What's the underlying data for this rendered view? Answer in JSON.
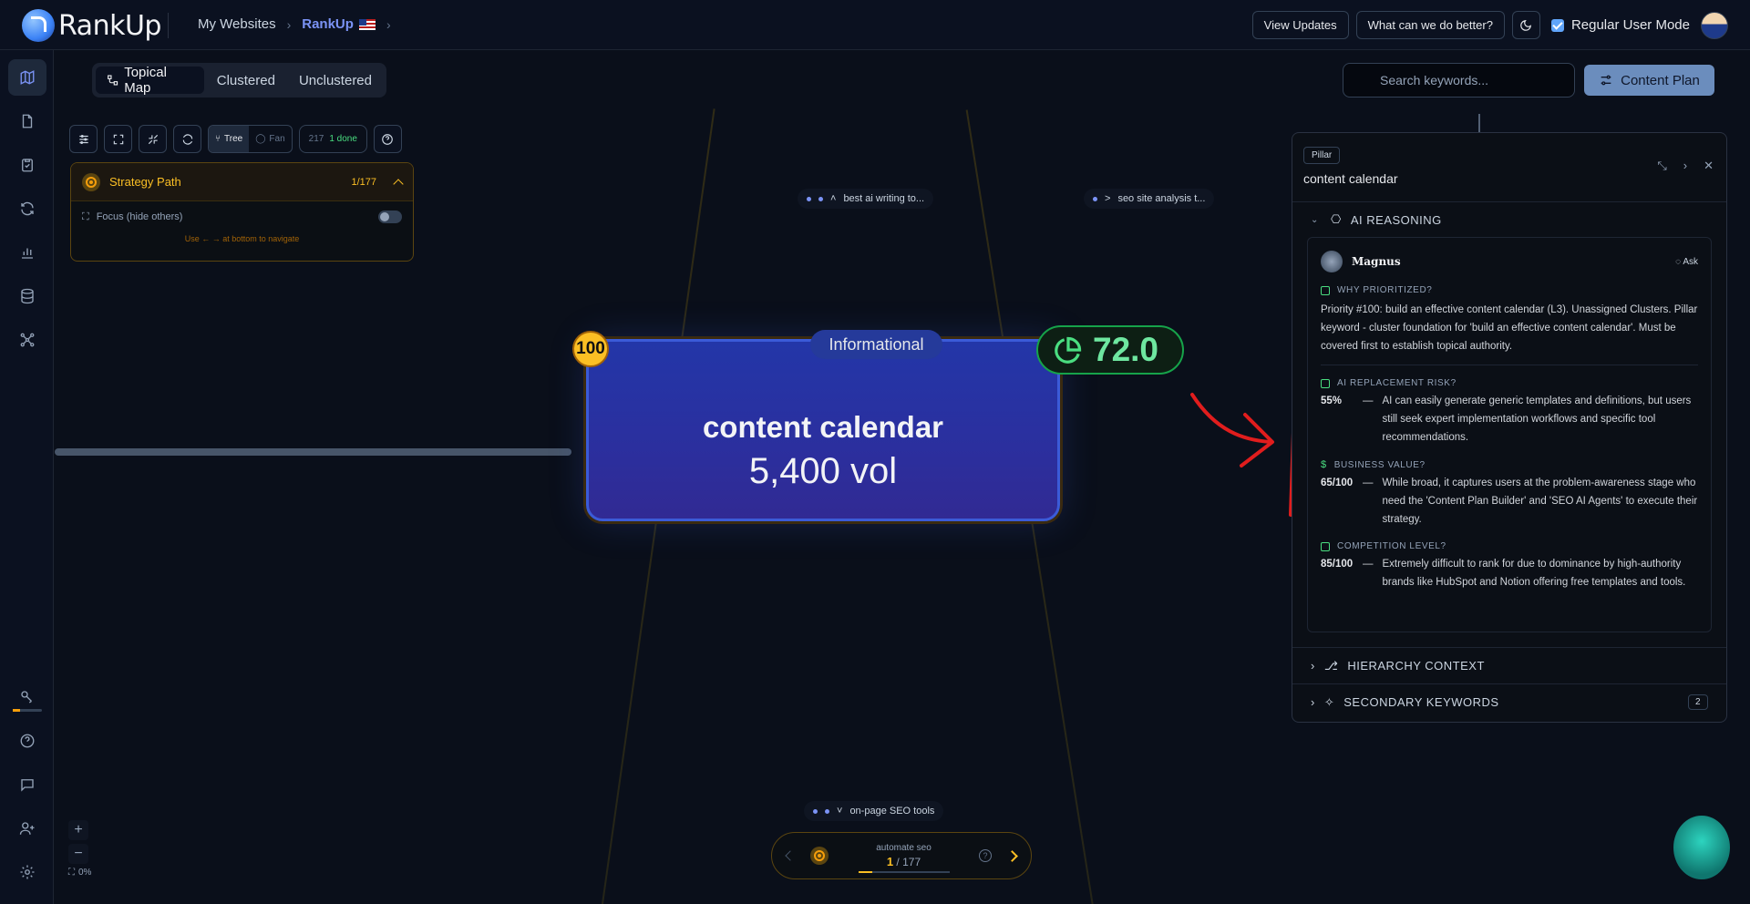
{
  "brand": {
    "name": "RankUp"
  },
  "breadcrumb": {
    "root": "My Websites",
    "site": "RankUp",
    "flag": "🇺🇸"
  },
  "header": {
    "view_updates": "View Updates",
    "feedback": "What can we do better?",
    "mode_label": "Regular User Mode",
    "mode_checked": true
  },
  "view_tabs": [
    "Topical Map",
    "Clustered",
    "Unclustered"
  ],
  "search": {
    "placeholder": "Search keywords..."
  },
  "content_plan": "Content Plan",
  "toolbar": {
    "tree": "Tree",
    "fan": "Fan",
    "count": "217",
    "done": "1 done"
  },
  "strategy": {
    "title": "Strategy Path",
    "count": "1/177",
    "focus": "Focus (hide others)",
    "hint": "Use ← → at bottom to navigate"
  },
  "mini_nodes": {
    "top_left": "best ai writing to...",
    "top_right": "seo site analysis t...",
    "bottom": "on-page SEO tools"
  },
  "main_node": {
    "rank": "100",
    "intent": "Informational",
    "title": "content calendar",
    "volume": "5,400 vol",
    "score": "72.0"
  },
  "bottom_nav": {
    "label": "automate seo",
    "current": "1",
    "total": "177"
  },
  "zoom": {
    "level": "0%"
  },
  "panel": {
    "tag": "Pillar",
    "title": "content calendar",
    "ai_section": "AI REASONING",
    "agent": "Magnus",
    "ask": "Ask",
    "why_label": "WHY PRIORITIZED?",
    "why_text": "Priority #100: build an effective content calendar (L3). Unassigned Clusters. Pillar keyword - cluster foundation for 'build an effective content calendar'. Must be covered first to establish topical authority.",
    "risk_label": "AI REPLACEMENT RISK?",
    "risk_value": "55%",
    "risk_text": "AI can easily generate generic templates and definitions, but users still seek expert implementation workflows and specific tool recommendations.",
    "business_label": "BUSINESS VALUE?",
    "business_value": "65/100",
    "business_text": "While broad, it captures users at the problem-awareness stage who need the 'Content Plan Builder' and 'SEO AI Agents' to execute their strategy.",
    "competition_label": "COMPETITION LEVEL?",
    "competition_value": "85/100",
    "competition_text": "Extremely difficult to rank for due to dominance by high-authority brands like HubSpot and Notion offering free templates and tools.",
    "hierarchy": "HIERARCHY CONTEXT",
    "secondary": "SECONDARY KEYWORDS",
    "secondary_count": "2"
  },
  "colors": {
    "accent": "#7b93f5",
    "score": "#4ade80",
    "gold": "#fbbf24",
    "annotation": "#e11d1d"
  }
}
